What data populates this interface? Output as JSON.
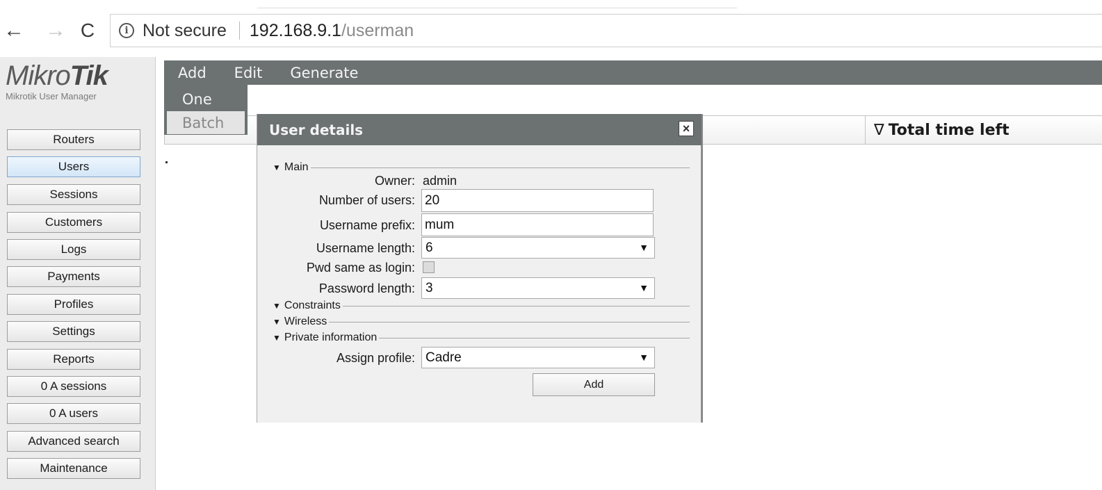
{
  "browser": {
    "nav": {
      "back": "←",
      "forward": "→",
      "reload": "C"
    },
    "security_label": "Not secure",
    "url_host": "192.168.9.1",
    "url_path": "/userman"
  },
  "brand": {
    "logo_light": "Mikro",
    "logo_bold": "Tik",
    "subtitle": "Mikrotik User Manager"
  },
  "sidebar": {
    "items": [
      {
        "label": "Routers"
      },
      {
        "label": "Users",
        "active": true
      },
      {
        "label": "Sessions"
      },
      {
        "label": "Customers"
      },
      {
        "label": "Logs"
      },
      {
        "label": "Payments"
      },
      {
        "label": "Profiles"
      },
      {
        "label": "Settings"
      },
      {
        "label": "Reports"
      },
      {
        "label": "0 A sessions"
      },
      {
        "label": "0 A users"
      },
      {
        "label": "Advanced search"
      },
      {
        "label": "Maintenance"
      }
    ]
  },
  "menubar": {
    "items": [
      "Add",
      "Edit",
      "Generate"
    ],
    "add_dropdown": {
      "items": [
        "One",
        "Batch"
      ],
      "highlighted": "Batch"
    }
  },
  "table": {
    "sort_icon": "∇",
    "visible_column": "Total time left"
  },
  "dialog": {
    "title": "User details",
    "close_glyph": "×",
    "sections": {
      "main": "Main",
      "constraints": "Constraints",
      "wireless": "Wireless",
      "private_info": "Private information"
    },
    "fields": {
      "owner_label": "Owner:",
      "owner_value": "admin",
      "num_users_label": "Number of users:",
      "num_users_value": "20",
      "prefix_label": "Username prefix:",
      "prefix_value": "mum",
      "username_length_label": "Username length:",
      "username_length_value": "6",
      "pwd_same_label": "Pwd same as login:",
      "pwd_same_checked": false,
      "password_length_label": "Password length:",
      "password_length_value": "3",
      "assign_profile_label": "Assign profile:",
      "assign_profile_value": "Cadre"
    },
    "submit_label": "Add"
  },
  "colors": {
    "header_gray": "#6c7171",
    "sidebar_bg": "#ececec",
    "active_item": "#d3e6f8",
    "dialog_bg": "#f0f0f0"
  }
}
